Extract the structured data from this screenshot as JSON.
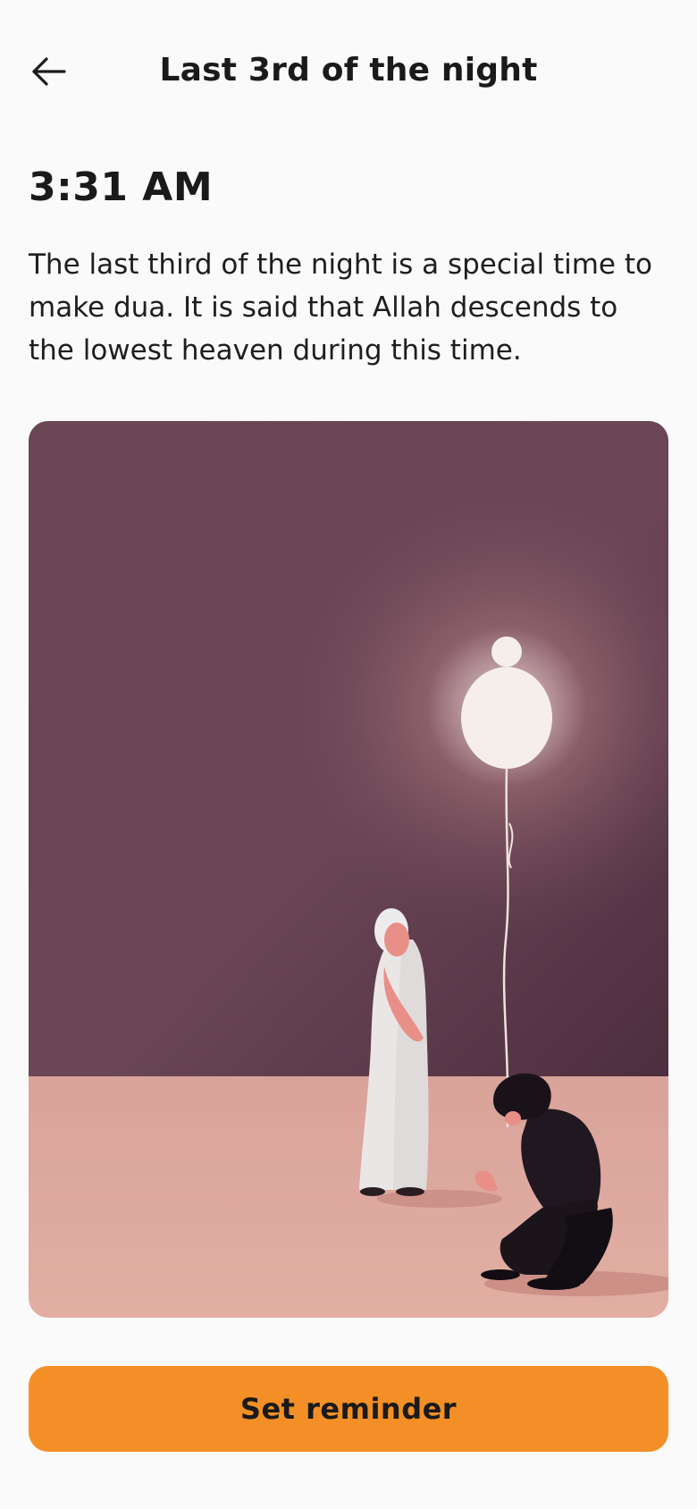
{
  "header": {
    "back_icon": "arrow-left-icon",
    "title": "Last 3rd of the night"
  },
  "main": {
    "time": "3:31 AM",
    "description": "The last third of the night is a special time to make dua. It is said that Allah descends to the lowest heaven during this time.",
    "illustration": "figures-praying-night-illustration"
  },
  "actions": {
    "reminder_label": "Set reminder"
  },
  "colors": {
    "accent": "#f38f26",
    "background": "#fafafa",
    "text": "#1a1a1a"
  }
}
